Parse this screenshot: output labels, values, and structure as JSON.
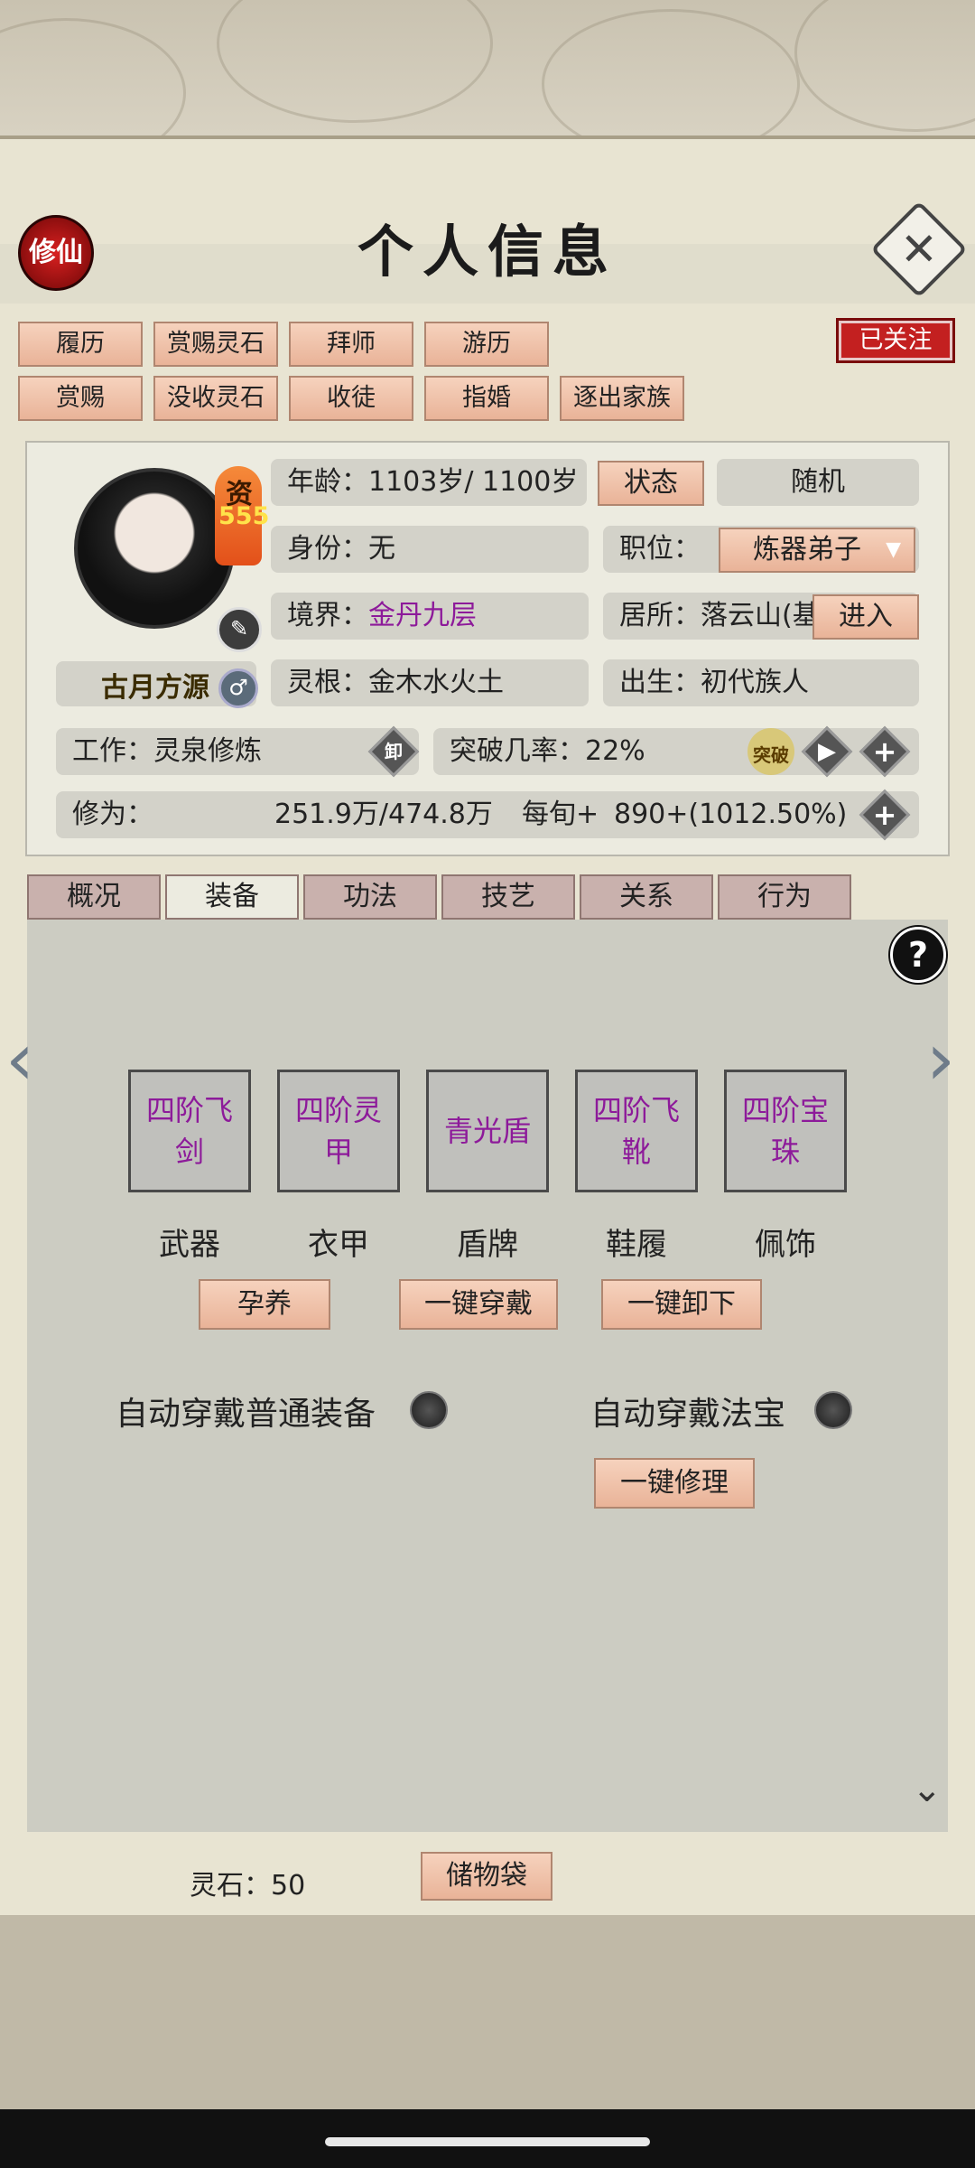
{
  "header": {
    "badge": "修仙",
    "title": "个人信息",
    "close_icon": "close-icon"
  },
  "actions": {
    "row1": [
      "履历",
      "赏赐灵石",
      "拜师",
      "游历"
    ],
    "row2": [
      "赏赐",
      "没收灵石",
      "收徒",
      "指婚",
      "逐出家族"
    ],
    "follow": "已关注"
  },
  "profile": {
    "talent_label": "资",
    "talent_value": "555",
    "name": "古月方源",
    "age": "年龄：1103岁/ 1100岁",
    "status_button": "状态",
    "random_button": "随机",
    "identity_label": "身份：",
    "identity_value": "无",
    "position_label": "职位：",
    "position_value": "炼器弟子",
    "realm_label": "境界：",
    "realm_value": "金丹九层",
    "residence": "居所：落云山(基",
    "enter_button": "进入",
    "root_label": "灵根：",
    "root_value": "金木水火土",
    "birth_label": "出生：",
    "birth_value": "初代族人",
    "work": "工作：灵泉修炼",
    "unload_icon": "卸",
    "breakthrough_label": "突破几率：",
    "breakthrough_value": "22%",
    "breakthrough_badge": "突破",
    "cultivation_label": "修为：",
    "cultivation_value": "251.9万/474.8万",
    "per_period_label": "每旬+",
    "per_period_value": "890+(1012.50%)"
  },
  "tabs": [
    "概况",
    "装备",
    "功法",
    "技艺",
    "关系",
    "行为"
  ],
  "active_tab": 1,
  "equipment": {
    "slots": [
      {
        "item": "四阶飞剑",
        "label": "武器"
      },
      {
        "item": "四阶灵甲",
        "label": "衣甲"
      },
      {
        "item": "青光盾",
        "label": "盾牌"
      },
      {
        "item": "四阶飞靴",
        "label": "鞋履"
      },
      {
        "item": "四阶宝珠",
        "label": "佩饰"
      }
    ],
    "buttons": [
      "孕养",
      "一键穿戴",
      "一键卸下"
    ],
    "auto_normal": "自动穿戴普通装备",
    "auto_treasure": "自动穿戴法宝",
    "repair": "一键修理"
  },
  "footer": {
    "stones": "灵石：50",
    "bag": "储物袋"
  },
  "colors": {
    "accent_purple": "#8d1a9a",
    "follow_red": "#c32020",
    "button_salmon": "#e9b398"
  }
}
